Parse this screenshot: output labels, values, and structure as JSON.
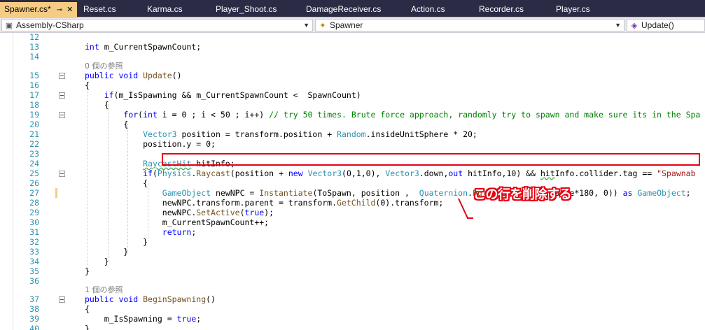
{
  "tabs": [
    {
      "label": "Spawner.cs*",
      "active": true,
      "pin": "⊸",
      "close": "✕"
    },
    {
      "label": "Reset.cs"
    },
    {
      "label": "Karma.cs"
    },
    {
      "label": "Player_Shoot.cs"
    },
    {
      "label": "DamageReceiver.cs"
    },
    {
      "label": "Action.cs"
    },
    {
      "label": "Recorder.cs"
    },
    {
      "label": "Player.cs"
    }
  ],
  "nav": {
    "project": "Assembly-CSharp",
    "class": "Spawner",
    "member": "Update()"
  },
  "refs": {
    "update_refs": "0 個の参照",
    "begin_refs": "1 個の参照"
  },
  "lines": {
    "l12": "12",
    "l13": "13",
    "l14": "14",
    "l15": "15",
    "l16": "16",
    "l17": "17",
    "l18": "18",
    "l19": "19",
    "l20": "20",
    "l21": "21",
    "l22": "22",
    "l23": "23",
    "l24": "24",
    "l25": "25",
    "l26": "26",
    "l27": "27",
    "l28": "28",
    "l29": "29",
    "l30": "30",
    "l31": "31",
    "l32": "32",
    "l33": "33",
    "l34": "34",
    "l35": "35",
    "l36": "36",
    "l37": "37",
    "l38": "38",
    "l39": "39",
    "l40": "40"
  },
  "annotation": "この行を削除する",
  "colors": {
    "highlight": "#e60012",
    "tab_active": "#f5cc84",
    "tab_bar": "#2b2b46"
  }
}
